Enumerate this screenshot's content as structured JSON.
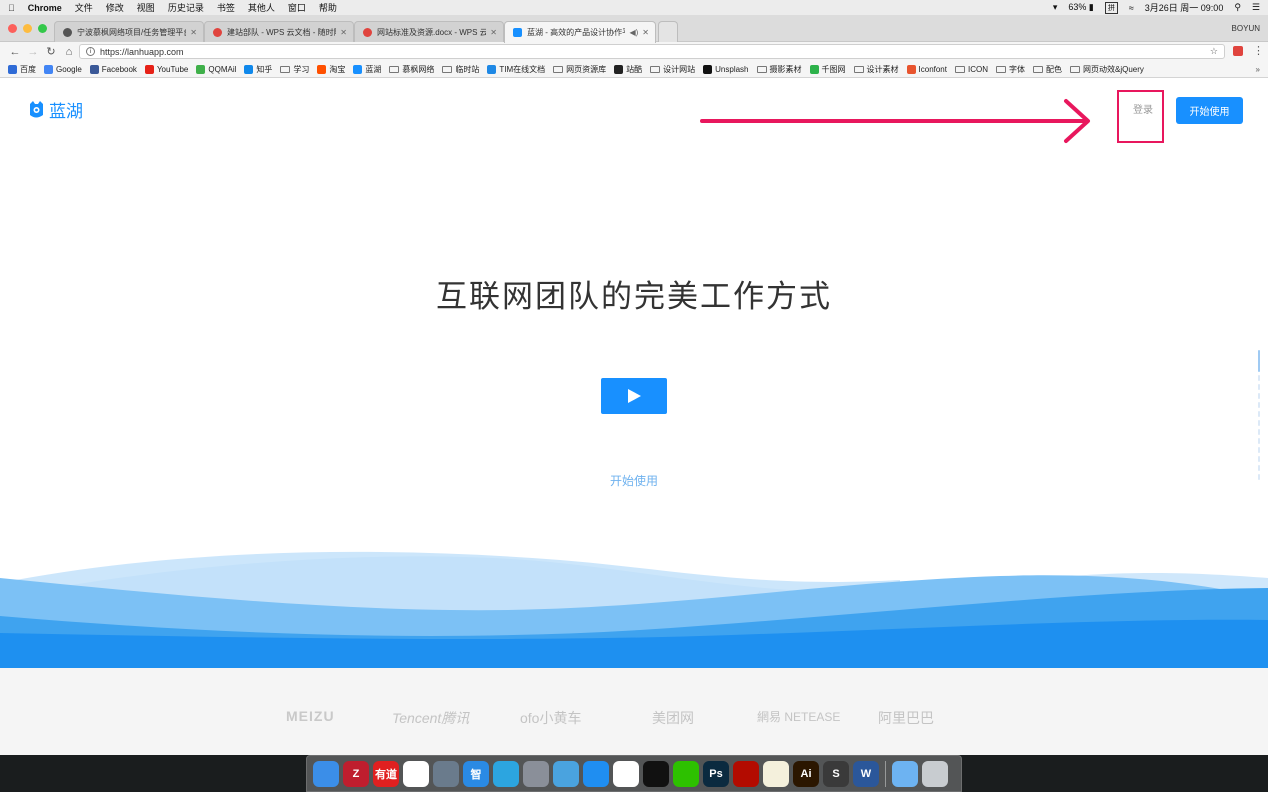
{
  "menubar": {
    "app": "Chrome",
    "items": [
      "文件",
      "修改",
      "视图",
      "历史记录",
      "书签",
      "其他人",
      "窗口",
      "帮助"
    ],
    "battery": "63%",
    "datetime": "3月26日 周一 09:00"
  },
  "tabs": [
    {
      "title": "宁波慕枫网络项目/任务管理平台",
      "icon": "generic-icon",
      "color": "#555555"
    },
    {
      "title": "建站部队 - WPS 云文档 - 随时随",
      "icon": "wps-icon",
      "color": "#e0443e"
    },
    {
      "title": "网站标准及资源.docx - WPS 云",
      "icon": "wps-icon",
      "color": "#e0443e"
    },
    {
      "title": "蓝湖 - 高效的产品设计协作平",
      "icon": "lanhu-icon",
      "color": "#1890ff",
      "active": true
    }
  ],
  "profile": "BOYUN",
  "address": {
    "url": "https://lanhuapp.com"
  },
  "bookmarks": [
    {
      "label": "百度",
      "type": "site",
      "color": "#2f6bd6"
    },
    {
      "label": "Google",
      "type": "site",
      "color": "#4285f4"
    },
    {
      "label": "Facebook",
      "type": "site",
      "color": "#3b5998"
    },
    {
      "label": "YouTube",
      "type": "site",
      "color": "#e62117"
    },
    {
      "label": "QQMAil",
      "type": "site",
      "color": "#3fb04a"
    },
    {
      "label": "知乎",
      "type": "site",
      "color": "#0f88eb"
    },
    {
      "label": "学习",
      "type": "folder"
    },
    {
      "label": "淘宝",
      "type": "site",
      "color": "#ff5000"
    },
    {
      "label": "蓝湖",
      "type": "site",
      "color": "#1890ff"
    },
    {
      "label": "慕枫网络",
      "type": "folder"
    },
    {
      "label": "临时站",
      "type": "folder"
    },
    {
      "label": "TIM在线文档",
      "type": "site",
      "color": "#1e88e5"
    },
    {
      "label": "网页资源库",
      "type": "folder"
    },
    {
      "label": "站酷",
      "type": "site",
      "color": "#222222"
    },
    {
      "label": "设计网站",
      "type": "folder"
    },
    {
      "label": "Unsplash",
      "type": "site",
      "color": "#111111"
    },
    {
      "label": "摄影素材",
      "type": "folder"
    },
    {
      "label": "千图网",
      "type": "site",
      "color": "#2db24b"
    },
    {
      "label": "设计素材",
      "type": "folder"
    },
    {
      "label": "Iconfont",
      "type": "site",
      "color": "#e8542e"
    },
    {
      "label": "ICON",
      "type": "folder"
    },
    {
      "label": "字体",
      "type": "folder"
    },
    {
      "label": "配色",
      "type": "folder"
    },
    {
      "label": "网页动效&jQuery",
      "type": "folder"
    }
  ],
  "site": {
    "logo_text": "蓝湖",
    "login": "登录",
    "cta": "开始使用",
    "hero_title": "互联网团队的完美工作方式",
    "start_link": "开始使用",
    "brand_color": "#1890ff",
    "annotation_color": "#e8175d",
    "partners": [
      "MEIZU",
      "Tencent腾讯",
      "ofo小黄车",
      "美团网",
      "網易 NETEASE",
      "阿里巴巴"
    ]
  },
  "dock": [
    {
      "name": "finder",
      "label": "",
      "color": "#3b8ee8"
    },
    {
      "name": "filezilla",
      "label": "Z",
      "color": "#bf1e2e"
    },
    {
      "name": "youdao",
      "label": "有道",
      "color": "#e02020"
    },
    {
      "name": "baidu-netdisk",
      "label": "",
      "color": "#ffffff"
    },
    {
      "name": "preview",
      "label": "",
      "color": "#6a7b8c"
    },
    {
      "name": "zhi",
      "label": "智",
      "color": "#2a8ae4"
    },
    {
      "name": "telegram",
      "label": "",
      "color": "#2ca5e0"
    },
    {
      "name": "launchpad",
      "label": "",
      "color": "#8a8f99"
    },
    {
      "name": "cloud",
      "label": "",
      "color": "#4aa3df"
    },
    {
      "name": "safari",
      "label": "",
      "color": "#1f8ef1"
    },
    {
      "name": "chrome",
      "label": "",
      "color": "#ffffff"
    },
    {
      "name": "qq",
      "label": "",
      "color": "#111111"
    },
    {
      "name": "wechat",
      "label": "",
      "color": "#2dc100"
    },
    {
      "name": "photoshop",
      "label": "Ps",
      "color": "#0b2a3f"
    },
    {
      "name": "acrobat",
      "label": "",
      "color": "#b30b00"
    },
    {
      "name": "notes",
      "label": "",
      "color": "#f4f0dc"
    },
    {
      "name": "illustrator",
      "label": "Ai",
      "color": "#2b1600"
    },
    {
      "name": "sublime",
      "label": "S",
      "color": "#3a3a3a"
    },
    {
      "name": "word",
      "label": "W",
      "color": "#2b579a"
    },
    {
      "name": "downloads",
      "label": "",
      "color": "#6db3f2"
    },
    {
      "name": "trash",
      "label": "",
      "color": "#c8ccd0"
    }
  ]
}
